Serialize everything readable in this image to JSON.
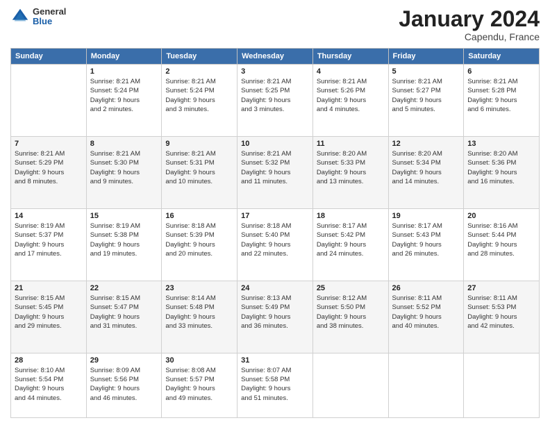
{
  "logo": {
    "general": "General",
    "blue": "Blue"
  },
  "header": {
    "month": "January 2024",
    "location": "Capendu, France"
  },
  "weekdays": [
    "Sunday",
    "Monday",
    "Tuesday",
    "Wednesday",
    "Thursday",
    "Friday",
    "Saturday"
  ],
  "weeks": [
    [
      {
        "day": "",
        "info": ""
      },
      {
        "day": "1",
        "info": "Sunrise: 8:21 AM\nSunset: 5:24 PM\nDaylight: 9 hours\nand 2 minutes."
      },
      {
        "day": "2",
        "info": "Sunrise: 8:21 AM\nSunset: 5:24 PM\nDaylight: 9 hours\nand 3 minutes."
      },
      {
        "day": "3",
        "info": "Sunrise: 8:21 AM\nSunset: 5:25 PM\nDaylight: 9 hours\nand 3 minutes."
      },
      {
        "day": "4",
        "info": "Sunrise: 8:21 AM\nSunset: 5:26 PM\nDaylight: 9 hours\nand 4 minutes."
      },
      {
        "day": "5",
        "info": "Sunrise: 8:21 AM\nSunset: 5:27 PM\nDaylight: 9 hours\nand 5 minutes."
      },
      {
        "day": "6",
        "info": "Sunrise: 8:21 AM\nSunset: 5:28 PM\nDaylight: 9 hours\nand 6 minutes."
      }
    ],
    [
      {
        "day": "7",
        "info": "Sunrise: 8:21 AM\nSunset: 5:29 PM\nDaylight: 9 hours\nand 8 minutes."
      },
      {
        "day": "8",
        "info": "Sunrise: 8:21 AM\nSunset: 5:30 PM\nDaylight: 9 hours\nand 9 minutes."
      },
      {
        "day": "9",
        "info": "Sunrise: 8:21 AM\nSunset: 5:31 PM\nDaylight: 9 hours\nand 10 minutes."
      },
      {
        "day": "10",
        "info": "Sunrise: 8:21 AM\nSunset: 5:32 PM\nDaylight: 9 hours\nand 11 minutes."
      },
      {
        "day": "11",
        "info": "Sunrise: 8:20 AM\nSunset: 5:33 PM\nDaylight: 9 hours\nand 13 minutes."
      },
      {
        "day": "12",
        "info": "Sunrise: 8:20 AM\nSunset: 5:34 PM\nDaylight: 9 hours\nand 14 minutes."
      },
      {
        "day": "13",
        "info": "Sunrise: 8:20 AM\nSunset: 5:36 PM\nDaylight: 9 hours\nand 16 minutes."
      }
    ],
    [
      {
        "day": "14",
        "info": "Sunrise: 8:19 AM\nSunset: 5:37 PM\nDaylight: 9 hours\nand 17 minutes."
      },
      {
        "day": "15",
        "info": "Sunrise: 8:19 AM\nSunset: 5:38 PM\nDaylight: 9 hours\nand 19 minutes."
      },
      {
        "day": "16",
        "info": "Sunrise: 8:18 AM\nSunset: 5:39 PM\nDaylight: 9 hours\nand 20 minutes."
      },
      {
        "day": "17",
        "info": "Sunrise: 8:18 AM\nSunset: 5:40 PM\nDaylight: 9 hours\nand 22 minutes."
      },
      {
        "day": "18",
        "info": "Sunrise: 8:17 AM\nSunset: 5:42 PM\nDaylight: 9 hours\nand 24 minutes."
      },
      {
        "day": "19",
        "info": "Sunrise: 8:17 AM\nSunset: 5:43 PM\nDaylight: 9 hours\nand 26 minutes."
      },
      {
        "day": "20",
        "info": "Sunrise: 8:16 AM\nSunset: 5:44 PM\nDaylight: 9 hours\nand 28 minutes."
      }
    ],
    [
      {
        "day": "21",
        "info": "Sunrise: 8:15 AM\nSunset: 5:45 PM\nDaylight: 9 hours\nand 29 minutes."
      },
      {
        "day": "22",
        "info": "Sunrise: 8:15 AM\nSunset: 5:47 PM\nDaylight: 9 hours\nand 31 minutes."
      },
      {
        "day": "23",
        "info": "Sunrise: 8:14 AM\nSunset: 5:48 PM\nDaylight: 9 hours\nand 33 minutes."
      },
      {
        "day": "24",
        "info": "Sunrise: 8:13 AM\nSunset: 5:49 PM\nDaylight: 9 hours\nand 36 minutes."
      },
      {
        "day": "25",
        "info": "Sunrise: 8:12 AM\nSunset: 5:50 PM\nDaylight: 9 hours\nand 38 minutes."
      },
      {
        "day": "26",
        "info": "Sunrise: 8:11 AM\nSunset: 5:52 PM\nDaylight: 9 hours\nand 40 minutes."
      },
      {
        "day": "27",
        "info": "Sunrise: 8:11 AM\nSunset: 5:53 PM\nDaylight: 9 hours\nand 42 minutes."
      }
    ],
    [
      {
        "day": "28",
        "info": "Sunrise: 8:10 AM\nSunset: 5:54 PM\nDaylight: 9 hours\nand 44 minutes."
      },
      {
        "day": "29",
        "info": "Sunrise: 8:09 AM\nSunset: 5:56 PM\nDaylight: 9 hours\nand 46 minutes."
      },
      {
        "day": "30",
        "info": "Sunrise: 8:08 AM\nSunset: 5:57 PM\nDaylight: 9 hours\nand 49 minutes."
      },
      {
        "day": "31",
        "info": "Sunrise: 8:07 AM\nSunset: 5:58 PM\nDaylight: 9 hours\nand 51 minutes."
      },
      {
        "day": "",
        "info": ""
      },
      {
        "day": "",
        "info": ""
      },
      {
        "day": "",
        "info": ""
      }
    ]
  ]
}
